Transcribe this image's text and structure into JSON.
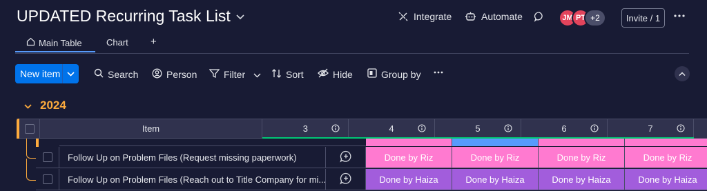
{
  "header": {
    "title": "UPDATED Recurring Task List",
    "integrate_label": "Integrate",
    "automate_label": "Automate",
    "avatars": [
      {
        "initials": "JM",
        "color": "#e2445c"
      },
      {
        "initials": "PT",
        "color": "#e2445c"
      }
    ],
    "more_count": "+2",
    "invite_label": "Invite / 1"
  },
  "tabs": [
    {
      "label": "Main Table"
    },
    {
      "label": "Chart"
    },
    {
      "label": "+"
    }
  ],
  "toolbar": {
    "new_item_label": "New item",
    "search_label": "Search",
    "person_label": "Person",
    "filter_label": "Filter",
    "sort_label": "Sort",
    "hide_label": "Hide",
    "group_by_label": "Group by"
  },
  "group": {
    "title": "2024",
    "color": "#fdab3d",
    "columns": [
      "Item",
      "3",
      "4",
      "5",
      "6",
      "7"
    ],
    "rows": [
      {
        "item": "Follow Up on Problem Files (Request missing paperwork)",
        "statuses": [
          "Done by Riz",
          "Done by Riz",
          "Done by Riz",
          "Done by Riz"
        ],
        "status_color": "#ff7ad0"
      },
      {
        "item": "Follow Up on Problem Files (Reach out to Title Company for mi...",
        "statuses": [
          "Done by Haiza",
          "Done by Haiza",
          "Done by Haiza",
          "Done by Haiza"
        ],
        "status_color": "#a25ddc"
      }
    ]
  },
  "colors": {
    "background": "#181b34",
    "accent": "#0073ea",
    "group": "#fdab3d",
    "riz": "#ff7ad0",
    "haiza": "#a25ddc",
    "status_bar": "#00c875"
  }
}
